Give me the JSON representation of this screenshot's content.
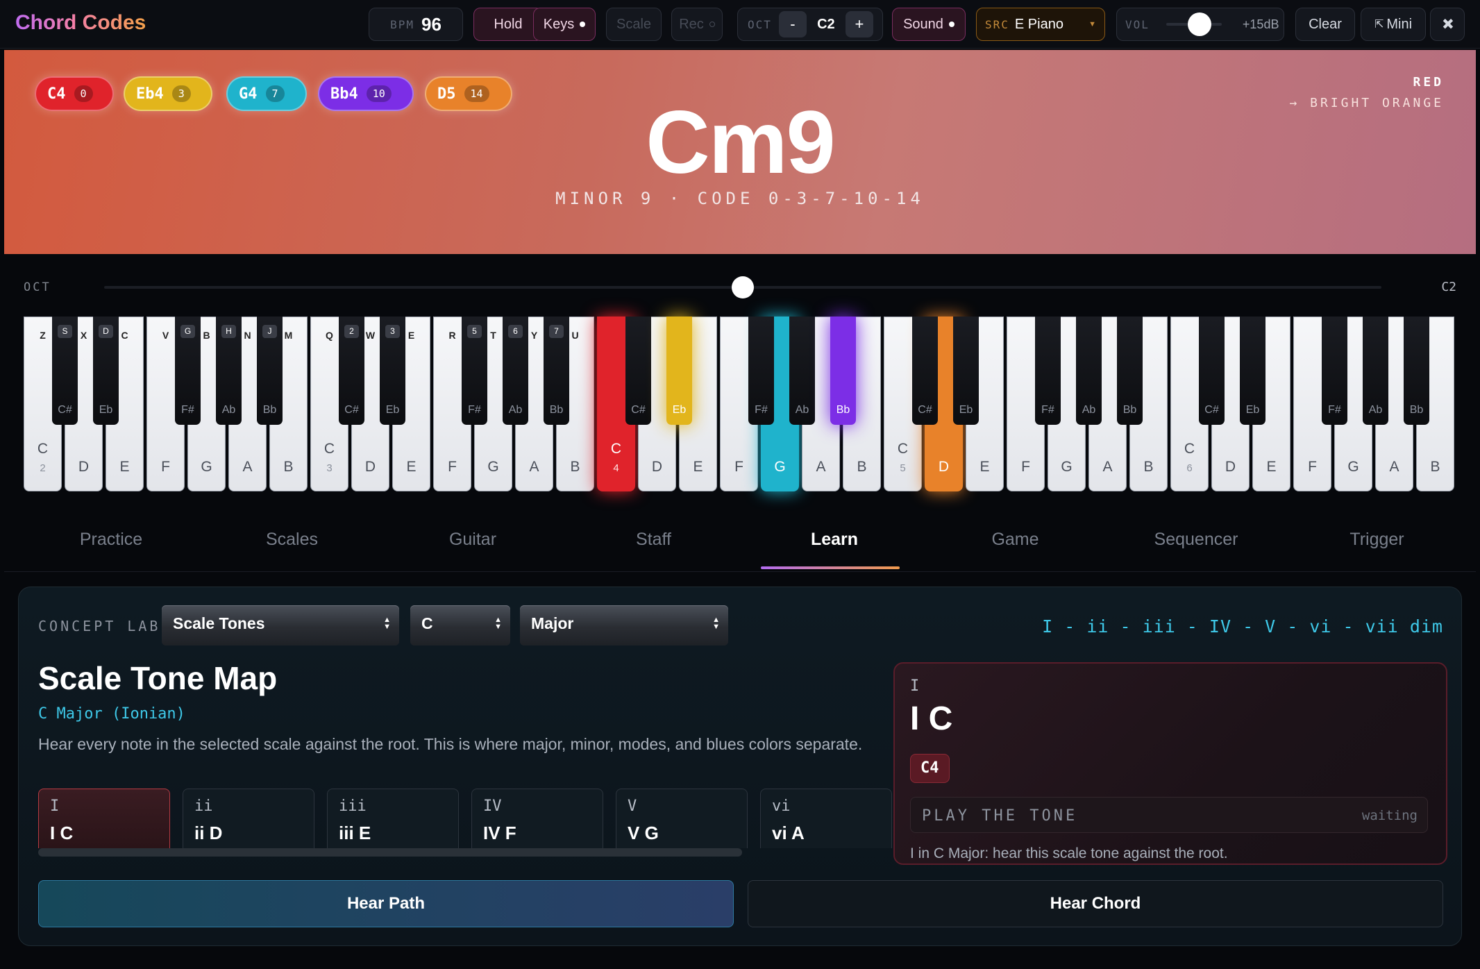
{
  "app": {
    "title": "Chord Codes"
  },
  "toolbar": {
    "bpm_label": "BPM",
    "bpm_value": "96",
    "hold_label": "Hold",
    "keys_label": "Keys",
    "scale_label": "Scale",
    "rec_label": "Rec",
    "oct_label": "OCT",
    "oct_minus": "-",
    "oct_value": "C2",
    "oct_plus": "+",
    "sound_label": "Sound",
    "src_label": "SRC",
    "src_value": "E Piano",
    "vol_label": "VOL",
    "vol_value": "+15dB",
    "vol_level": 0.6,
    "clear_label": "Clear",
    "mini_label": "Mini"
  },
  "chord": {
    "name": "Cm9",
    "description": "MINOR 9 · CODE 0-3-7-10-14",
    "color_from": "RED",
    "color_to": "→ BRIGHT ORANGE",
    "tones": [
      {
        "note": "C4",
        "interval": "0",
        "color": "#e0232b"
      },
      {
        "note": "Eb4",
        "interval": "3",
        "color": "#e2b51c"
      },
      {
        "note": "G4",
        "interval": "7",
        "color": "#1fb3cc"
      },
      {
        "note": "Bb4",
        "interval": "10",
        "color": "#7c2ee6"
      },
      {
        "note": "D5",
        "interval": "14",
        "color": "#e8822a"
      }
    ]
  },
  "octave_slider": {
    "label": "OCT",
    "value": "C2",
    "position": 0.5
  },
  "keyboard": {
    "octave_labels": [
      "2",
      "3",
      "4",
      "5",
      "6"
    ],
    "white_notes": [
      "C",
      "D",
      "E",
      "F",
      "G",
      "A",
      "B"
    ],
    "black_notes": [
      "C#",
      "Eb",
      "F#",
      "Ab",
      "Bb"
    ],
    "white_keys_row1": [
      "Z",
      "X",
      "C",
      "V",
      "B",
      "N",
      "M"
    ],
    "black_keys_row1": [
      "S",
      "D",
      "G",
      "H",
      "J"
    ],
    "white_keys_row2": [
      "Q",
      "W",
      "E",
      "R",
      "T",
      "Y",
      "U"
    ],
    "black_keys_row2": [
      "2",
      "3",
      "5",
      "6",
      "7"
    ]
  },
  "tabs": [
    {
      "label": "Practice"
    },
    {
      "label": "Scales"
    },
    {
      "label": "Guitar"
    },
    {
      "label": "Staff"
    },
    {
      "label": "Learn",
      "active": true
    },
    {
      "label": "Game"
    },
    {
      "label": "Sequencer"
    },
    {
      "label": "Trigger"
    }
  ],
  "learn": {
    "concept_label": "CONCEPT LAB",
    "concept_select": "Scale Tones",
    "key_select": "C",
    "mode_select": "Major",
    "progression": "I - ii - iii - IV - V - vi - vii dim",
    "title": "Scale Tone Map",
    "subtitle": "C Major (Ionian)",
    "description": "Hear every note in the selected scale against the root. This is where major, minor, modes, and blues colors separate.",
    "degrees": [
      {
        "roman": "I",
        "name": "I C"
      },
      {
        "roman": "ii",
        "name": "ii D"
      },
      {
        "roman": "iii",
        "name": "iii E"
      },
      {
        "roman": "IV",
        "name": "IV F"
      },
      {
        "roman": "V",
        "name": "V G"
      },
      {
        "roman": "vi",
        "name": "vi A"
      }
    ],
    "detail": {
      "roman": "I",
      "name": "I C",
      "note": "C4",
      "play_label": "PLAY THE TONE",
      "play_status": "waiting",
      "text": "I in C Major: hear this scale tone against the root."
    },
    "hear_path_label": "Hear Path",
    "hear_chord_label": "Hear Chord"
  }
}
